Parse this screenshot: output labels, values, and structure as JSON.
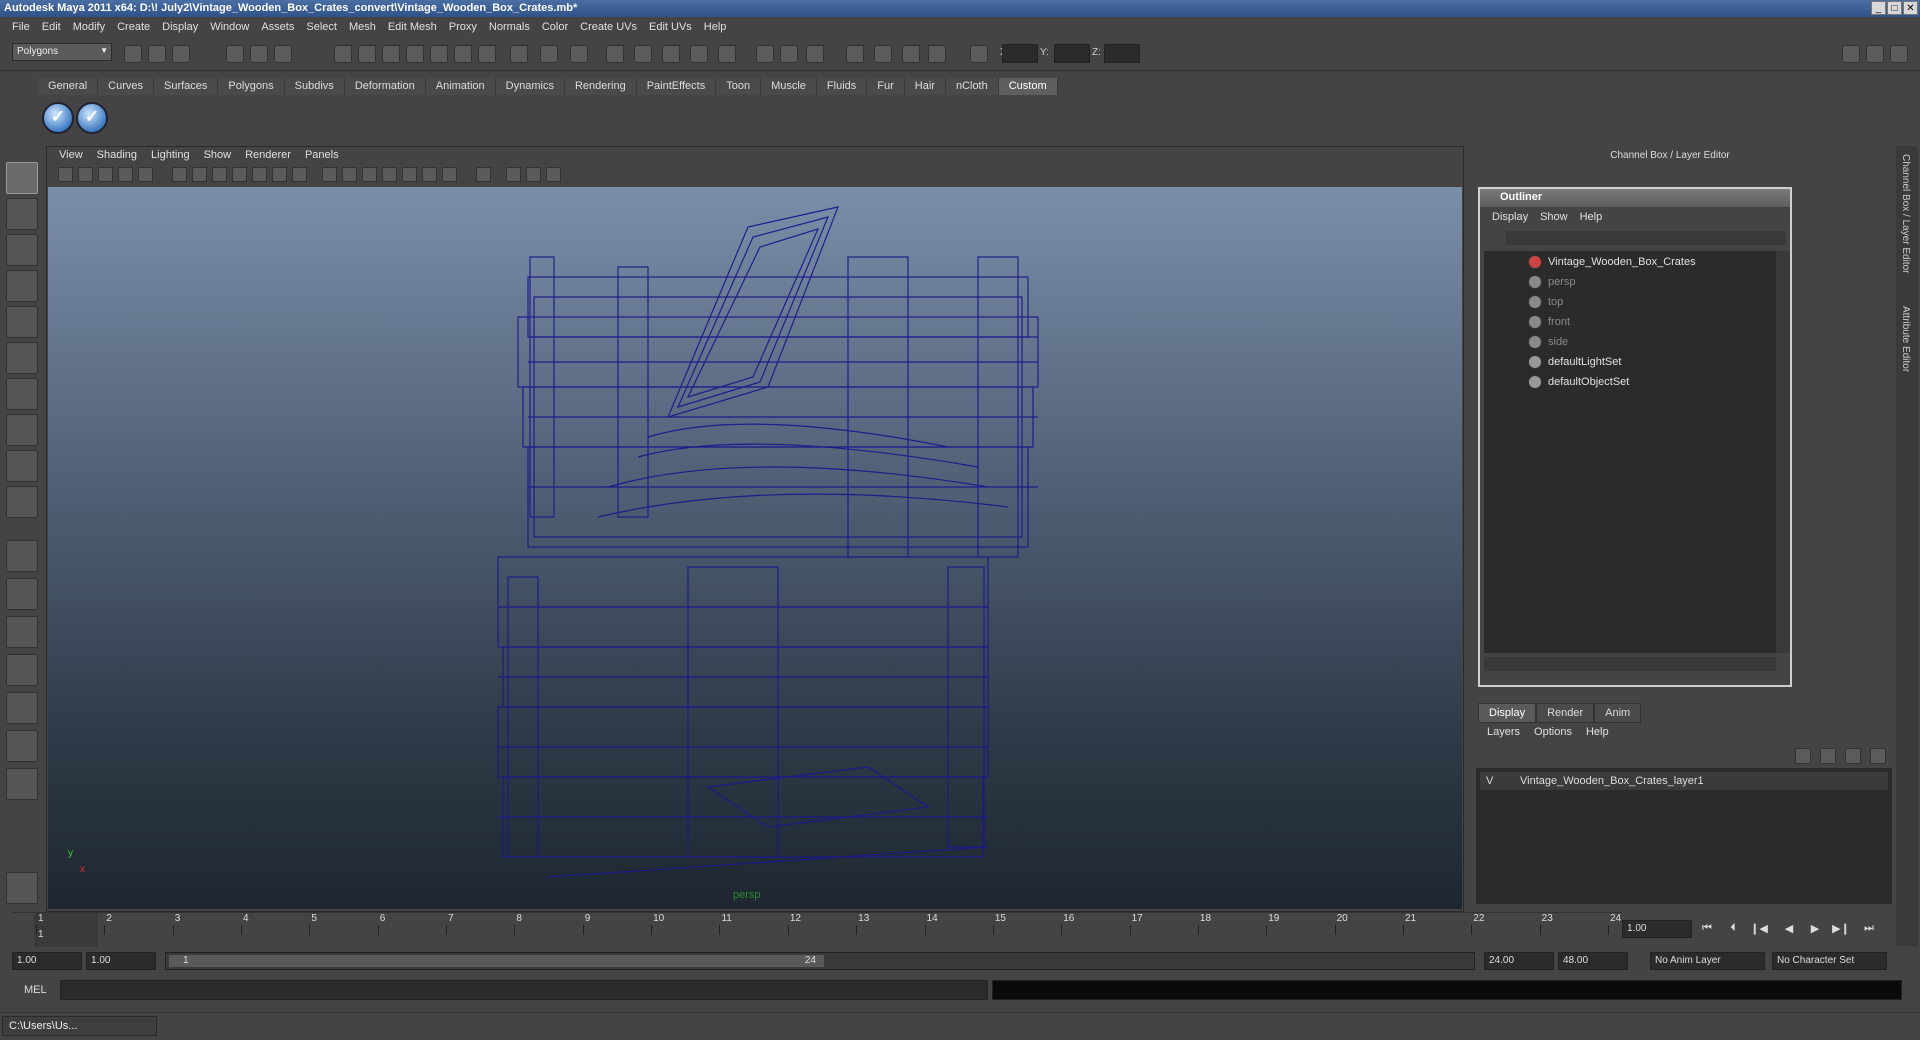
{
  "app": {
    "title": "Autodesk Maya 2011 x64: D:\\! July2\\Vintage_Wooden_Box_Crates_convert\\Vintage_Wooden_Box_Crates.mb*"
  },
  "menubar": [
    "File",
    "Edit",
    "Modify",
    "Create",
    "Display",
    "Window",
    "Assets",
    "Select",
    "Mesh",
    "Edit Mesh",
    "Proxy",
    "Normals",
    "Color",
    "Create UVs",
    "Edit UVs",
    "Help"
  ],
  "statusline": {
    "mode": "Polygons",
    "x_label": "X:",
    "y_label": "Y:",
    "z_label": "Z:"
  },
  "shelf": {
    "tabs": [
      "General",
      "Curves",
      "Surfaces",
      "Polygons",
      "Subdivs",
      "Deformation",
      "Animation",
      "Dynamics",
      "Rendering",
      "PaintEffects",
      "Toon",
      "Muscle",
      "Fluids",
      "Fur",
      "Hair",
      "nCloth",
      "Custom"
    ],
    "active_tab": "Custom"
  },
  "panel": {
    "menu": [
      "View",
      "Shading",
      "Lighting",
      "Show",
      "Renderer",
      "Panels"
    ],
    "camera_label": "persp",
    "axis_y": "y",
    "axis_x": "x"
  },
  "right": {
    "title": "Channel Box / Layer Editor",
    "side_tab_1": "Channel Box / Layer Editor",
    "side_tab_2": "Attribute Editor"
  },
  "outliner": {
    "title": "Outliner",
    "menu": [
      "Display",
      "Show",
      "Help"
    ],
    "items": [
      {
        "label": "Vintage_Wooden_Box_Crates",
        "dim": false
      },
      {
        "label": "persp",
        "dim": true
      },
      {
        "label": "top",
        "dim": true
      },
      {
        "label": "front",
        "dim": true
      },
      {
        "label": "side",
        "dim": true
      },
      {
        "label": "defaultLightSet",
        "dim": false
      },
      {
        "label": "defaultObjectSet",
        "dim": false
      }
    ]
  },
  "layers": {
    "tabs": [
      "Display",
      "Render",
      "Anim"
    ],
    "active_tab": "Display",
    "menu": [
      "Layers",
      "Options",
      "Help"
    ],
    "row": {
      "visible": "V",
      "name": "Vintage_Wooden_Box_Crates_layer1"
    }
  },
  "timeline": {
    "ticks": [
      "1",
      "2",
      "3",
      "4",
      "5",
      "6",
      "7",
      "8",
      "9",
      "10",
      "11",
      "12",
      "13",
      "14",
      "15",
      "16",
      "17",
      "18",
      "19",
      "20",
      "21",
      "22",
      "23",
      "24"
    ],
    "current_frame": "1.00",
    "current_marker": "1"
  },
  "range": {
    "start": "1.00",
    "playback_start": "1.00",
    "slider_start": "1",
    "slider_end": "24",
    "playback_end": "24.00",
    "end": "48.00",
    "anim_layer": "No Anim Layer",
    "character_set": "No Character Set"
  },
  "command": {
    "label": "MEL"
  },
  "taskbar": {
    "item": "C:\\Users\\Us..."
  },
  "colors": {
    "wireframe": "#1a1a8c",
    "viewport_top": "#7b8ea8",
    "viewport_bottom": "#1e2630",
    "title_bar": "#2f5288"
  }
}
